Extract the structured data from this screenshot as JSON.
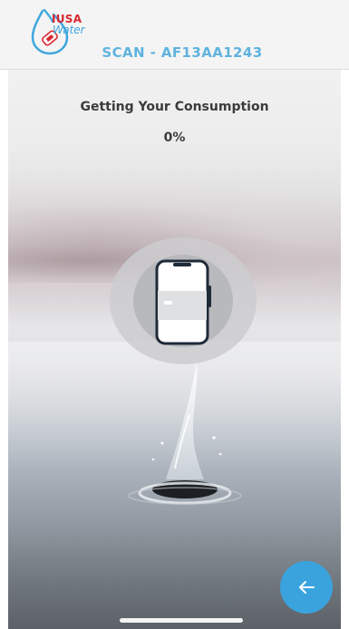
{
  "header": {
    "logo_brand": "IUSA",
    "logo_sub": "Water",
    "scan_title": "SCAN - AF13AA1243",
    "logo_icon": "water-drop-meter-icon"
  },
  "main": {
    "status_title": "Getting Your Consumption",
    "progress_text": "0%",
    "progress": 0,
    "scan_graphic_icon": "phone-scan-icon"
  },
  "footer": {
    "back_icon": "arrow-left-icon"
  },
  "colors": {
    "accent": "#3aa3de",
    "brand_red": "#d8262e",
    "title_blue": "#5fb3df",
    "text_dark": "#3b3b3b",
    "phone_outline": "#1f2a38"
  }
}
